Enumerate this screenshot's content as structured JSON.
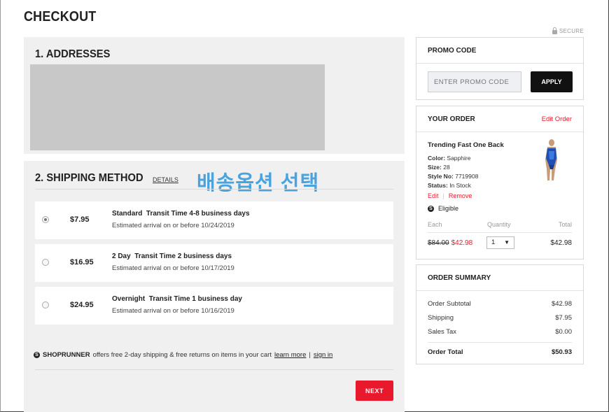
{
  "page": {
    "title": "CHECKOUT",
    "secure_label": "SECURE"
  },
  "addresses": {
    "title": "1. ADDRESSES"
  },
  "shipping": {
    "title": "2. SHIPPING METHOD",
    "details_label": "DETAILS",
    "annotation": "배송옵션 선택",
    "options": [
      {
        "price": "$7.95",
        "name": "Standard  Transit Time 4-8 business days",
        "eta": "Estimated arrival on or before 10/24/2019",
        "selected": true
      },
      {
        "price": "$16.95",
        "name": "2 Day  Transit Time 2 business days",
        "eta": "Estimated arrival on or before 10/17/2019",
        "selected": false
      },
      {
        "price": "$24.95",
        "name": "Overnight  Transit Time 1 business day",
        "eta": "Estimated arrival on or before 10/16/2019",
        "selected": false
      }
    ],
    "shoprunner": {
      "brand": "SHOPRUNNER",
      "text": "offers free 2-day shipping & free returns on items in your cart",
      "learn_more": "learn more",
      "separator": "|",
      "sign_in": "sign in"
    },
    "next_label": "NEXT"
  },
  "promo": {
    "title": "PROMO CODE",
    "placeholder": "ENTER PROMO CODE",
    "apply_label": "APPLY"
  },
  "order": {
    "title": "YOUR ORDER",
    "edit_label": "Edit Order",
    "item": {
      "name": "Trending Fast One Back",
      "color_label": "Color:",
      "color": "Sapphire",
      "size_label": "Size:",
      "size": "28",
      "style_label": "Style No:",
      "style": "7719908",
      "status_label": "Status:",
      "status": "In Stock",
      "edit": "Edit",
      "remove": "Remove",
      "eligible": "Eligible",
      "old_price": "$84.00",
      "new_price": "$42.98",
      "quantity": "1",
      "line_total": "$42.98"
    },
    "columns": {
      "each": "Each",
      "quantity": "Quantity",
      "total": "Total"
    }
  },
  "summary": {
    "title": "ORDER SUMMARY",
    "rows": [
      {
        "label": "Order Subtotal",
        "value": "$42.98"
      },
      {
        "label": "Shipping",
        "value": "$7.95"
      },
      {
        "label": "Sales Tax",
        "value": "$0.00"
      }
    ],
    "total_label": "Order Total",
    "total_value": "$50.93"
  },
  "colors": {
    "accent_red": "#e8192c",
    "panel_gray": "#f0f0f0",
    "annotation_blue": "#4aa3df"
  },
  "icons": [
    "lock-icon",
    "shoprunner-icon",
    "radio-icon",
    "chevron-down-icon"
  ]
}
